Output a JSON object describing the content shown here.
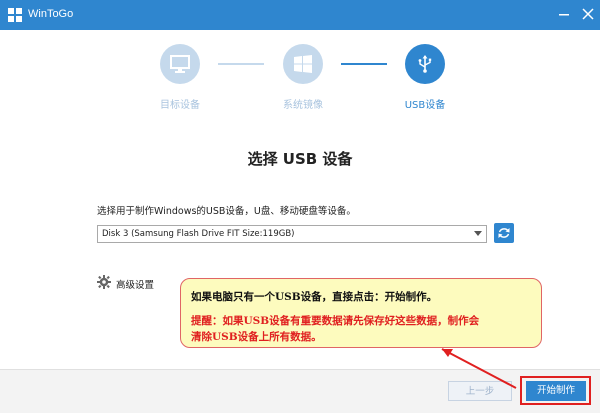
{
  "window": {
    "title": "WinToGo"
  },
  "steps": [
    {
      "label": "目标设备",
      "icon": "monitor-icon",
      "state": "inactive"
    },
    {
      "label": "系统镜像",
      "icon": "windows-logo-icon",
      "state": "inactive"
    },
    {
      "label": "USB设备",
      "icon": "usb-icon",
      "state": "active"
    }
  ],
  "page": {
    "title": "选择 USB 设备",
    "instruction": "选择用于制作Windows的USB设备，U盘、移动硬盘等设备。"
  },
  "device_select": {
    "value": "Disk 3 (Samsung Flash Drive FIT  Size:119GB)"
  },
  "advanced": {
    "label": "高级设置"
  },
  "callout": {
    "line1": "如果电脑只有一个USB设备，直接点击：开始制作。",
    "line2": "提醒：如果USB设备有重要数据请先保存好这些数据，制作会",
    "line3": "清除USB设备上所有数据。"
  },
  "footer": {
    "back_label": "上一步",
    "start_label": "开始制作"
  },
  "colors": {
    "accent": "#2f86cf",
    "accent_light": "#c5d9ec",
    "callout_border": "#e06565",
    "callout_bg": "#fdfbbe",
    "warning_text": "#e02020"
  }
}
